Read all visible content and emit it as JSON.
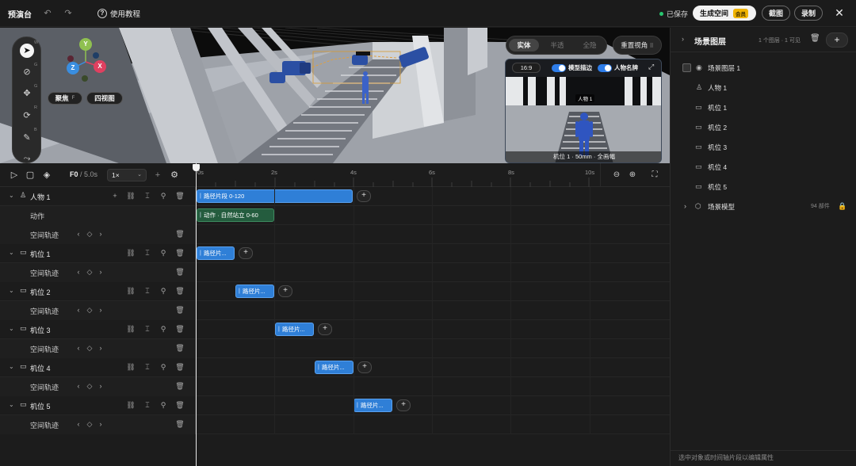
{
  "topbar": {
    "app_title": "预演台",
    "tutorial_label": "使用教程",
    "save_status": "已保存",
    "generate_label": "生成空间",
    "member_badge": "会员",
    "screenshot_label": "截图",
    "record_label": "录制"
  },
  "viewport": {
    "tool_keys": [
      "W",
      "G",
      "G",
      "R",
      "B"
    ],
    "gizmo": {
      "y": "Y",
      "z": "Z",
      "x": "X"
    },
    "focus_label": "聚焦",
    "focus_key": "F",
    "fourview_label": "四视图",
    "modes": [
      "实体",
      "半透",
      "全隐"
    ],
    "active_mode": "实体",
    "reset_view_label": "重置视角"
  },
  "preview": {
    "ratio": "16:9",
    "outline_label": "模型描边",
    "nameplate_label": "人物名牌",
    "person_tag": "人物 1",
    "caption": "机位 1 · 50mm · 全画幅"
  },
  "timeline": {
    "frame_current": "F0",
    "frame_total": "/ 5.0s",
    "speed": "1×",
    "ticks": [
      "0s",
      "2s",
      "4s",
      "6s",
      "8s",
      "10s"
    ],
    "rows": [
      {
        "name": "人物 1",
        "type": "person",
        "clip": "路径片段 0-120"
      },
      {
        "name": "动作",
        "type": "sub",
        "clip": "动作 · 自然站立 0-60"
      },
      {
        "name": "空间轨迹",
        "type": "sub-track"
      },
      {
        "name": "机位 1",
        "type": "camera",
        "clip": "路径片..."
      },
      {
        "name": "空间轨迹",
        "type": "sub-track"
      },
      {
        "name": "机位 2",
        "type": "camera",
        "clip": "路径片..."
      },
      {
        "name": "空间轨迹",
        "type": "sub-track"
      },
      {
        "name": "机位 3",
        "type": "camera",
        "clip": "路径片..."
      },
      {
        "name": "空间轨迹",
        "type": "sub-track"
      },
      {
        "name": "机位 4",
        "type": "camera",
        "clip": "路径片..."
      },
      {
        "name": "空间轨迹",
        "type": "sub-track"
      },
      {
        "name": "机位 5",
        "type": "camera",
        "clip": "路径片..."
      },
      {
        "name": "空间轨迹",
        "type": "sub-track"
      }
    ]
  },
  "panel": {
    "title": "场景图层",
    "count": "1 个图层 · 1 可见",
    "layer_name": "场景图层 1",
    "items": [
      "人物 1",
      "机位 1",
      "机位 2",
      "机位 3",
      "机位 4",
      "机位 5"
    ],
    "model_label": "场景模型",
    "model_count": "94 部件",
    "footer_hint": "选中对象或时间轴片段以编辑属性"
  },
  "colors": {
    "clip_blue": "#2f7fd7",
    "clip_green": "#245c3e",
    "accent_toggle": "#2e7de9",
    "saved_dot": "#28c76f",
    "member_badge": "#f0b400"
  }
}
